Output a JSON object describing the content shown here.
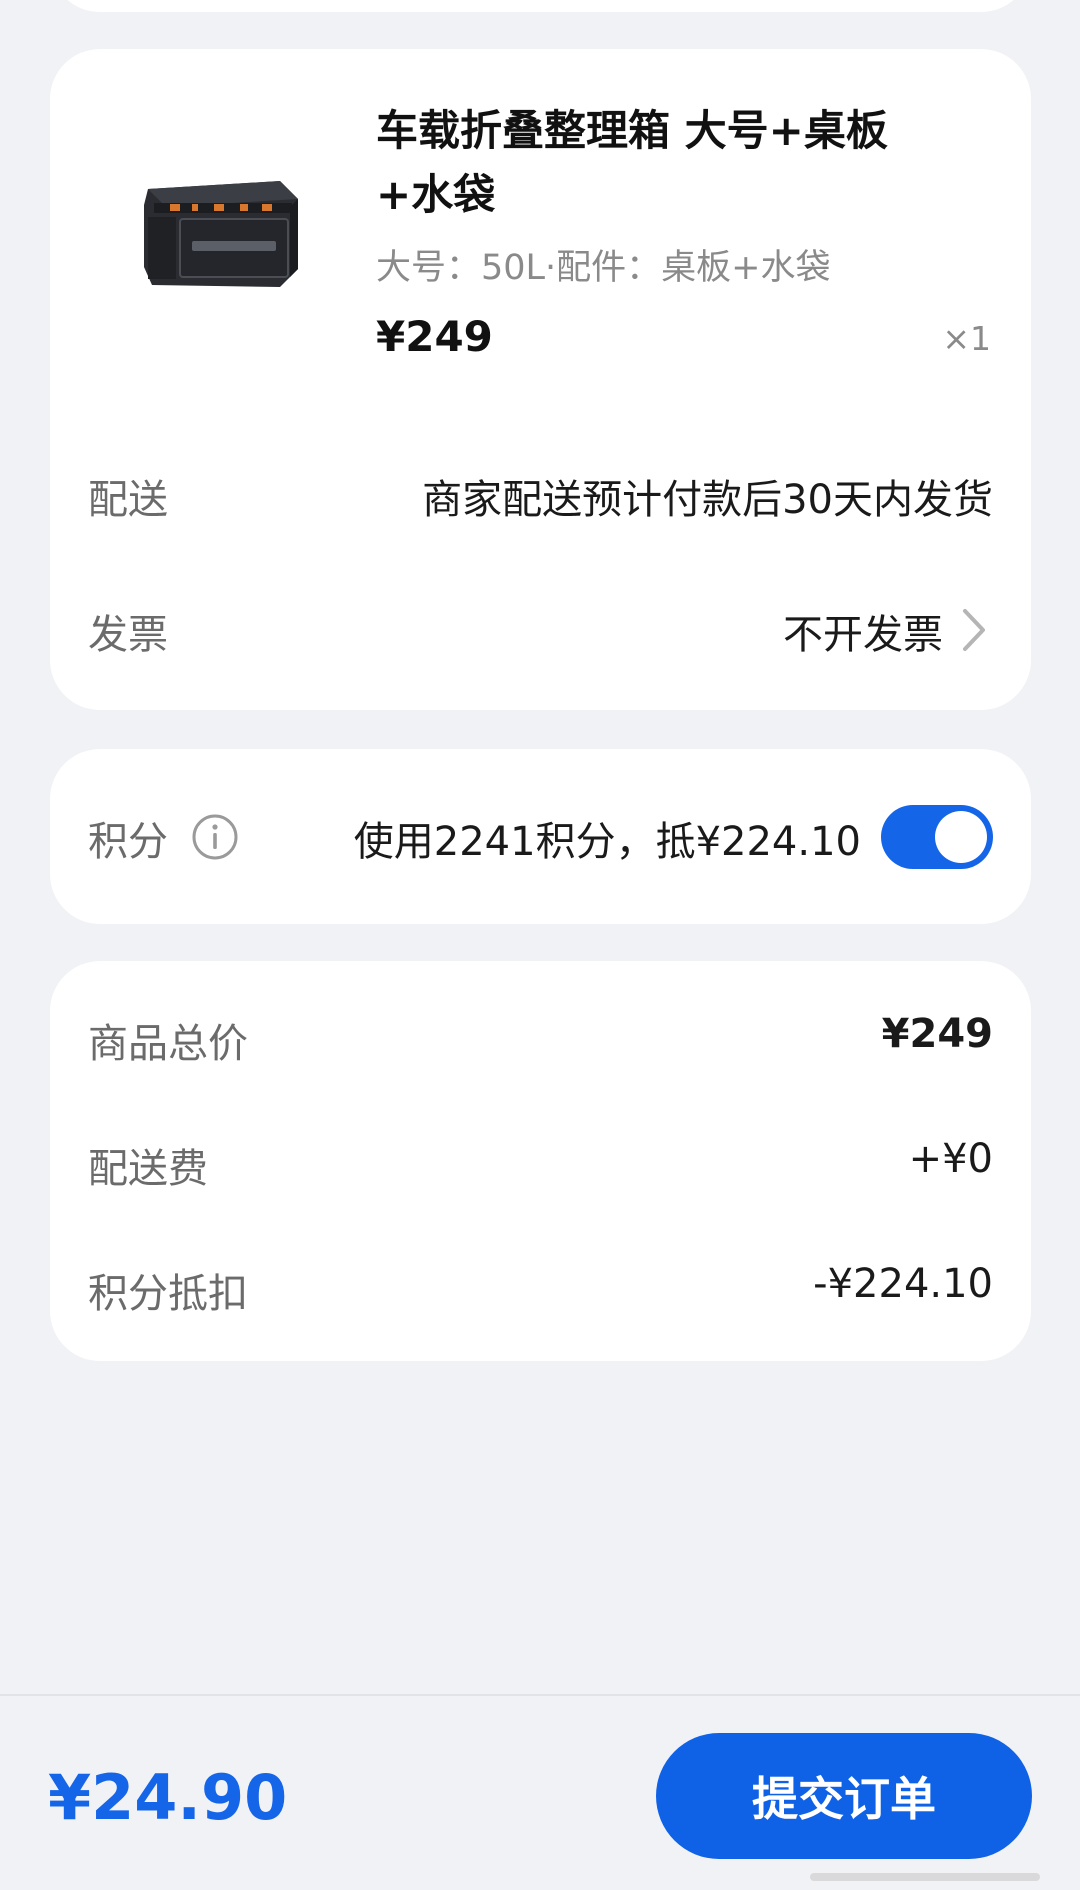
{
  "product": {
    "title": "车载折叠整理箱 大号+桌板+水袋",
    "spec": "大号：50L·配件：桌板+水袋",
    "price": "¥249",
    "quantity": "×1",
    "image_icon": "storage-box-image"
  },
  "delivery": {
    "label": "配送",
    "value": "商家配送预计付款后30天内发货"
  },
  "invoice": {
    "label": "发票",
    "value": "不开发票"
  },
  "points": {
    "label": "积分",
    "info_icon": "info-icon",
    "description": "使用2241积分，抵¥224.10",
    "toggle_on": true
  },
  "summary": {
    "rows": [
      {
        "label": "商品总价",
        "value": "¥249"
      },
      {
        "label": "配送费",
        "value": "+¥0"
      },
      {
        "label": "积分抵扣",
        "value": "-¥224.10"
      }
    ]
  },
  "footer": {
    "total": "¥24.90",
    "submit_label": "提交订单"
  },
  "colors": {
    "accent": "#1565e8",
    "background": "#f1f2f5"
  }
}
